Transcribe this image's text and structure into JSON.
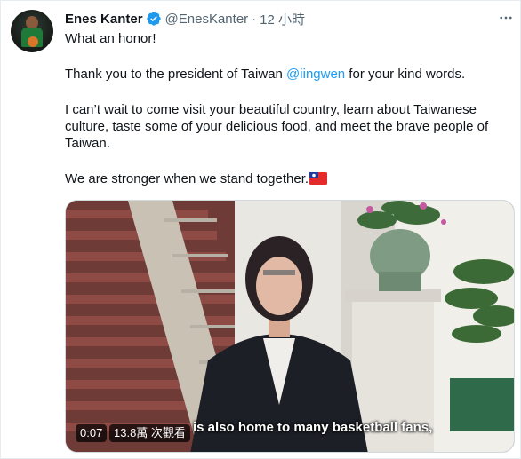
{
  "tweet": {
    "author_name": "Enes Kanter",
    "handle": "@EnesKanter",
    "separator": "·",
    "time": "12 小時",
    "paragraphs": {
      "p1": "What an honor!",
      "p2_before": "Thank you to the president of Taiwan ",
      "p2_mention": "@iingwen",
      "p2_after": " for your kind words.",
      "p3_line1": "I can’t wait to come visit your beautiful country, learn about Taiwanese",
      "p3_line2": "culture, taste some of your delicious food, and meet the brave people of",
      "p3_line3": "Taiwan.",
      "p4": "We are stronger when we stand together."
    },
    "icons": {
      "verified": "verified-badge-icon",
      "more": "more-options-icon",
      "flag": "taiwan-flag-emoji"
    }
  },
  "video": {
    "subtitle": "is also home to many basketball fans,",
    "duration": "0:07",
    "views": "13.8萬 次觀看"
  },
  "colors": {
    "link": "#1d9bf0",
    "secondary_text": "#536471",
    "primary_text": "#0f1419",
    "verified": "#1d9bf0"
  }
}
